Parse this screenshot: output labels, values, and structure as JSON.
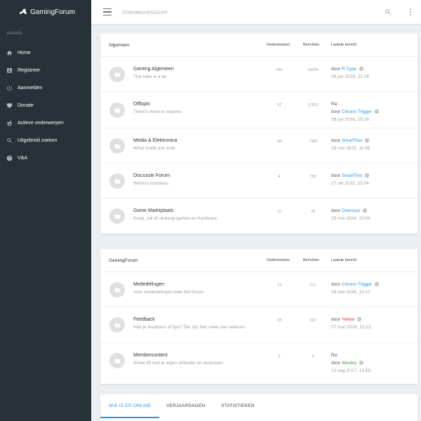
{
  "app": {
    "name": "GamingForum"
  },
  "sidebar": {
    "heading": "HOOFD",
    "items": [
      {
        "label": "Home",
        "icon": "home-icon"
      },
      {
        "label": "Registreer",
        "icon": "register-icon"
      },
      {
        "label": "Aanmelden",
        "icon": "power-icon"
      },
      {
        "label": "Donate",
        "icon": "heart-icon"
      },
      {
        "label": "Actieve onderwerpen",
        "icon": "fire-icon"
      },
      {
        "label": "Uitgebreid zoeken",
        "icon": "search-icon"
      },
      {
        "label": "V&A",
        "icon": "help-icon"
      }
    ]
  },
  "topbar": {
    "breadcrumb": "FORUMOVERZICHT"
  },
  "columns": {
    "topics": "Onderwerpen",
    "posts": "Berichten",
    "last": "Laatste bericht"
  },
  "colors": {
    "link": "#2196f3",
    "user_red": "#e53935",
    "user_green": "#43a047",
    "accent": "#2196f3"
  },
  "categories": [
    {
      "name": "Algemeen",
      "forums": [
        {
          "title": "Gaming Algemeen",
          "desc": "The cake is a lie.",
          "topics": "249",
          "posts": "19426",
          "re": "",
          "by": "door",
          "user": "R-Type",
          "date": "26 jun 2026, 22:24"
        },
        {
          "title": "Offtopic",
          "desc": "There's more to explore.",
          "topics": "57",
          "posts": "17810",
          "re": "Re:",
          "by": "door",
          "user": "Chrono Trigger",
          "date": "08 jun 2026, 19:28"
        },
        {
          "title": "Media & Elektronica",
          "desc": "What made you look.",
          "topics": "28",
          "posts": "7385",
          "re": "",
          "by": "door",
          "user": "SmartTies",
          "date": "19 nov 2025, 11:56"
        },
        {
          "title": "Discussie Forum",
          "desc": "Serious business.",
          "topics": "4",
          "posts": "760",
          "re": "",
          "by": "door",
          "user": "SmartTies",
          "date": "17 okt 2022, 15:04"
        },
        {
          "title": "Game Marktplaats",
          "desc": "Koop, ruil of verkoop games en hardware.",
          "topics": "15",
          "posts": "76",
          "re": "",
          "by": "door",
          "user": "Oversoul",
          "date": "15 mei 2024, 22:04"
        }
      ]
    },
    {
      "name": "GamingForum",
      "forums": [
        {
          "title": "Mededelingen",
          "desc": "Voor mededelingen over het forum.",
          "topics": "13",
          "posts": "217",
          "re": "",
          "by": "door",
          "user": "Chrono Trigger",
          "date": "16 mei 2026, 10:17"
        },
        {
          "title": "Feedback",
          "desc": "Heb je feedback of tips? Die zijn hier meer dan welkom.",
          "topics": "23",
          "posts": "297",
          "re": "",
          "by": "door",
          "user": "Yellow",
          "date": "07 mar 2026, 22:23"
        },
        {
          "title": "Membercontent",
          "desc": "Show off met je eigen artikelen en recensies.",
          "topics": "2",
          "posts": "5",
          "re": "Re:",
          "by": "door",
          "user": "Wesley",
          "date": "10 aug 2017, 13:59"
        }
      ]
    }
  ],
  "bottom_tabs": [
    "WIE IS ER ONLINE",
    "VERJAARDAGEN",
    "STATISTIEKEN"
  ]
}
